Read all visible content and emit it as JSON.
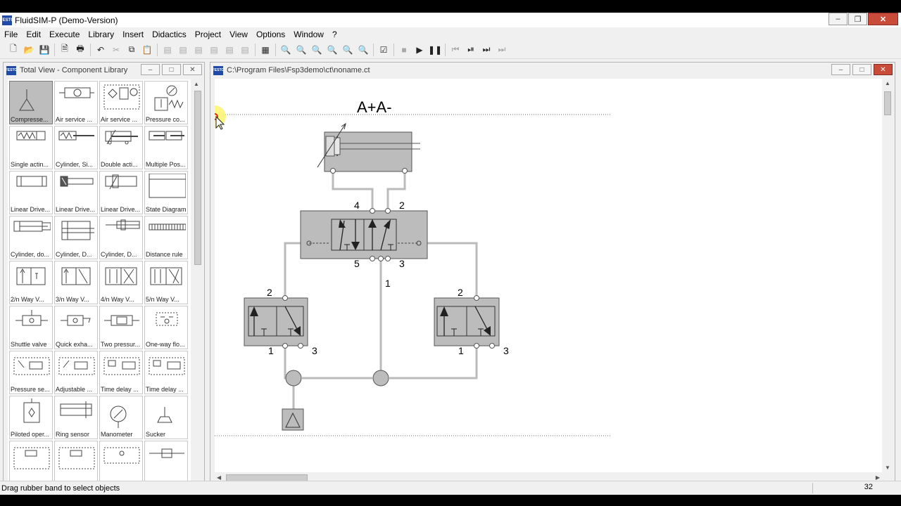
{
  "window": {
    "title": "FluidSIM-P (Demo-Version)",
    "logo_text": "FESTO"
  },
  "menu": [
    "File",
    "Edit",
    "Execute",
    "Library",
    "Insert",
    "Didactics",
    "Project",
    "View",
    "Options",
    "Window",
    "?"
  ],
  "library": {
    "title": "Total View - Component Library",
    "items": [
      "Compresse...",
      "Air service ...",
      "Air service ...",
      "Pressure co...",
      "Single actin...",
      "Cylinder, Si...",
      "Double acti...",
      "Multiple Pos...",
      "Linear Drive...",
      "Linear Drive...",
      "Linear Drive...",
      "State Diagram",
      "Cylinder, do...",
      "Cylinder, D...",
      "Cylinder, D...",
      "Distance rule",
      "2/n Way V...",
      "3/n Way V...",
      "4/n Way V...",
      "5/n Way V...",
      "Shuttle valve",
      "Quick exha...",
      "Two pressur...",
      "One-way flo...",
      "Pressure se...",
      "Adjustable ...",
      "Time delay ...",
      "Time delay ...",
      "Piloted oper...",
      "Ring sensor",
      "Manometer",
      "Sucker",
      "",
      "",
      "",
      ""
    ]
  },
  "circuit": {
    "title": "C:\\Program Files\\Fsp3demo\\ct\\noname.ct",
    "heading": "A+A-",
    "ports": {
      "p4": "4",
      "p2": "2",
      "p5": "5",
      "p3": "3",
      "p1": "1",
      "l2": "2",
      "l1": "1",
      "l3": "3",
      "r2": "2",
      "r1": "1",
      "r3": "3"
    }
  },
  "status": {
    "message": "Drag rubber band to select objects",
    "value": "32"
  }
}
